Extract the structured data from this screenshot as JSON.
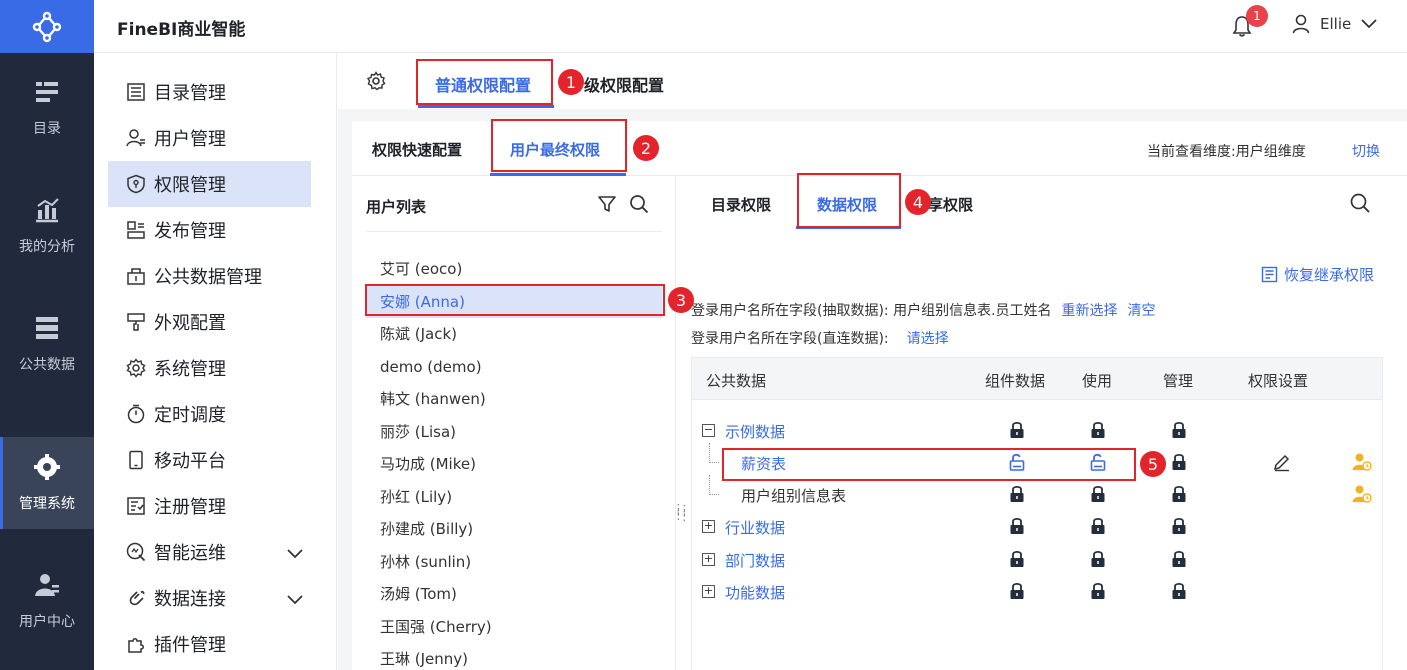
{
  "app": {
    "title": "FineBI商业智能"
  },
  "header": {
    "notification_count": "1",
    "user_name": "Ellie"
  },
  "rail": {
    "items": [
      {
        "label": "目录",
        "icon": "catalog-icon"
      },
      {
        "label": "我的分析",
        "icon": "analysis-icon"
      },
      {
        "label": "公共数据",
        "icon": "public-data-icon"
      },
      {
        "label": "管理系统",
        "icon": "admin-gear-icon",
        "active": true
      },
      {
        "label": "用户中心",
        "icon": "user-center-icon"
      }
    ]
  },
  "sidebar": {
    "items": [
      {
        "label": "目录管理",
        "icon": "list-icon"
      },
      {
        "label": "用户管理",
        "icon": "user-icon"
      },
      {
        "label": "权限管理",
        "icon": "shield-icon",
        "active": true
      },
      {
        "label": "发布管理",
        "icon": "publish-icon"
      },
      {
        "label": "公共数据管理",
        "icon": "data-manage-icon"
      },
      {
        "label": "外观配置",
        "icon": "brush-icon"
      },
      {
        "label": "系统管理",
        "icon": "gear-icon"
      },
      {
        "label": "定时调度",
        "icon": "timer-icon"
      },
      {
        "label": "移动平台",
        "icon": "mobile-icon"
      },
      {
        "label": "注册管理",
        "icon": "register-icon"
      },
      {
        "label": "智能运维",
        "icon": "ops-icon",
        "expandable": true
      },
      {
        "label": "数据连接",
        "icon": "link-icon",
        "expandable": true
      },
      {
        "label": "插件管理",
        "icon": "plugin-icon"
      }
    ]
  },
  "top_tabs": {
    "tab1": "普通权限配置",
    "tab2": "级权限配置"
  },
  "sub_tabs": {
    "quick": "权限快速配置",
    "final": "用户最终权限"
  },
  "dimension": {
    "label": "当前查看维度:用户组维度",
    "switch": "切换"
  },
  "user_list": {
    "title": "用户列表",
    "users": [
      "艾可 (eoco)",
      "安娜 (Anna)",
      "陈斌 (Jack)",
      "demo (demo)",
      "韩文 (hanwen)",
      "丽莎 (Lisa)",
      "马功成 (Mike)",
      "孙红 (Lily)",
      "孙建成 (Billy)",
      "孙林 (sunlin)",
      "汤姆 (Tom)",
      "王国强 (Cherry)",
      "王琳 (Jenny)"
    ],
    "selected_index": 1
  },
  "perm_tabs": {
    "catalog": "目录权限",
    "data": "数据权限",
    "share": "共享权限"
  },
  "restore": "恢复继承权限",
  "fields": {
    "extract_label": "登录用户名所在字段(抽取数据): 用户组别信息表.员工姓名",
    "extract_reselect": "重新选择",
    "extract_clear": "清空",
    "direct_label": "登录用户名所在字段(直连数据):",
    "direct_select": "请选择"
  },
  "table": {
    "headers": {
      "name": "公共数据",
      "component": "组件数据",
      "use": "使用",
      "manage": "管理",
      "setting": "权限设置"
    },
    "rows": [
      {
        "name": "示例数据",
        "level": 0,
        "expander": "−",
        "component": "locked",
        "use": "locked",
        "manage": "locked"
      },
      {
        "name": "薪资表",
        "level": 1,
        "component": "unlocked",
        "use": "unlocked",
        "manage": "locked",
        "edit": true,
        "user_setting": true
      },
      {
        "name": "用户组别信息表",
        "level": 1,
        "component": "locked",
        "use": "locked",
        "manage": "locked",
        "user_setting": true
      },
      {
        "name": "行业数据",
        "level": 0,
        "expander": "+",
        "component": "locked",
        "use": "locked",
        "manage": "locked"
      },
      {
        "name": "部门数据",
        "level": 0,
        "expander": "+",
        "component": "locked",
        "use": "locked",
        "manage": "locked"
      },
      {
        "name": "功能数据",
        "level": 0,
        "expander": "+",
        "component": "locked",
        "use": "locked",
        "manage": "locked"
      }
    ]
  },
  "annotations": [
    "1",
    "2",
    "3",
    "4",
    "5"
  ],
  "colors": {
    "accent": "#3a6be6",
    "rail": "#212a3c",
    "annotation": "#e3242b"
  }
}
